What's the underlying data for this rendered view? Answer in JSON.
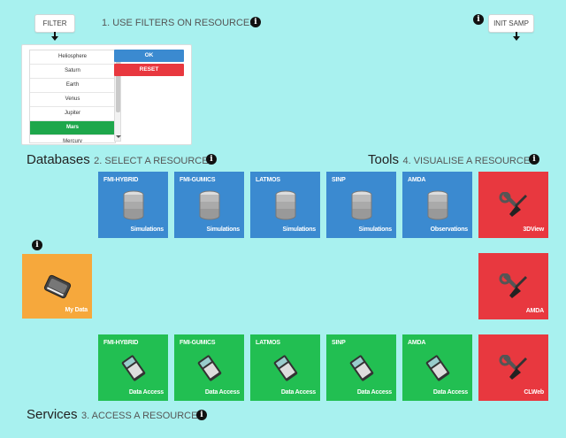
{
  "top": {
    "filter_button": "FILTER",
    "step1": "1. USE FILTERS ON RESOURCES",
    "init_button": "INIT SAMP"
  },
  "filter_panel": {
    "planets": [
      "Heliosphere",
      "Saturn",
      "Earth",
      "Venus",
      "Jupiter",
      "Mars",
      "Mercury"
    ],
    "selected": "Mars",
    "ok_label": "OK",
    "reset_label": "RESET"
  },
  "databases": {
    "title": "Databases",
    "step": "2. SELECT A RESOURCE",
    "tiles": [
      {
        "name": "FMI-HYBRID",
        "type": "Simulations"
      },
      {
        "name": "FMI-GUMICS",
        "type": "Simulations"
      },
      {
        "name": "LATMOS",
        "type": "Simulations"
      },
      {
        "name": "SINP",
        "type": "Simulations"
      },
      {
        "name": "AMDA",
        "type": "Observations"
      }
    ]
  },
  "tools": {
    "title": "Tools",
    "step": "4. VISUALISE A RESOURCE",
    "tiles": [
      "3DView",
      "AMDA",
      "CLWeb"
    ]
  },
  "my_data": {
    "label": "My Data"
  },
  "services": {
    "title": "Services",
    "step": "3. ACCESS A RESOURCE",
    "tiles": [
      {
        "name": "FMI-HYBRID",
        "type": "Data Access"
      },
      {
        "name": "FMI-GUMICS",
        "type": "Data Access"
      },
      {
        "name": "LATMOS",
        "type": "Data Access"
      },
      {
        "name": "SINP",
        "type": "Data Access"
      },
      {
        "name": "AMDA",
        "type": "Data Access"
      }
    ]
  },
  "colors": {
    "background": "#a8f1ef",
    "database_blue": "#3b8ad0",
    "service_green": "#22bf52",
    "tool_red": "#e8383f",
    "mydata_orange": "#f6a83c",
    "ok_blue": "#3b8ad0",
    "reset_red": "#e8383f",
    "selected_green": "#1ea74b"
  },
  "icons": {
    "info": "info-icon",
    "database": "database-icon",
    "calculator": "calculator-icon",
    "tools": "wrench-screwdriver-icon",
    "hard_drive": "hard-drive-icon",
    "arrow": "arrow-down-icon"
  }
}
